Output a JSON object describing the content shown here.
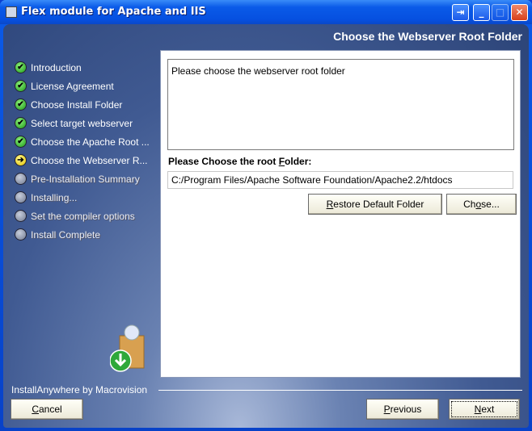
{
  "window": {
    "title": "Flex module for Apache and IIS",
    "icon": "installer-icon"
  },
  "heading": "Choose the Webserver Root Folder",
  "steps": [
    {
      "label": "Introduction",
      "status": "done"
    },
    {
      "label": "License Agreement",
      "status": "done"
    },
    {
      "label": "Choose Install Folder",
      "status": "done"
    },
    {
      "label": "Select target webserver",
      "status": "done"
    },
    {
      "label": "Choose the Apache Root ...",
      "status": "done"
    },
    {
      "label": "Choose the Webserver R...",
      "status": "current"
    },
    {
      "label": "Pre-Installation Summary",
      "status": "todo"
    },
    {
      "label": "Installing...",
      "status": "todo"
    },
    {
      "label": "Set the compiler options",
      "status": "todo"
    },
    {
      "label": "Install Complete",
      "status": "todo"
    }
  ],
  "main": {
    "description": "Please choose the webserver root folder",
    "folder_label_pre": "Please Choose the root ",
    "folder_label_key": "F",
    "folder_label_post": "older:",
    "folder_value": "C:/Program Files/Apache Software Foundation/Apache2.2/htdocs",
    "restore_key": "R",
    "restore_rest": "estore Default Folder",
    "choose_key": "o",
    "choose_pre": "Ch",
    "choose_post": "se..."
  },
  "footer": {
    "brand": "InstallAnywhere by Macrovision",
    "cancel_key": "C",
    "cancel_rest": "ancel",
    "previous_key": "P",
    "previous_rest": "revious",
    "next_key": "N",
    "next_rest": "ext"
  }
}
